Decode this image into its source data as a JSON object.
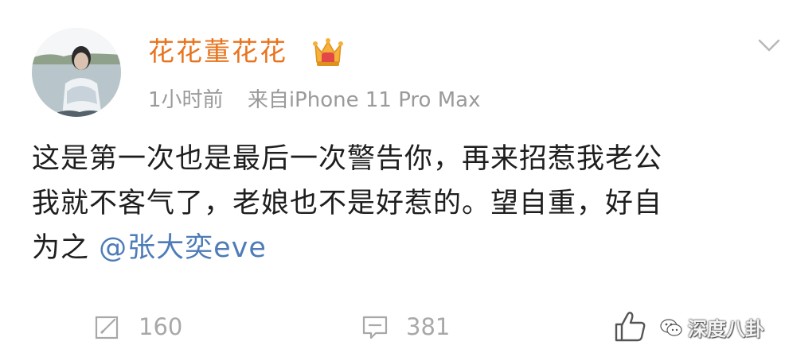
{
  "post": {
    "author": {
      "name": "花花董花花"
    },
    "time": "1小时前",
    "source": "来自iPhone 11 Pro Max",
    "text_lines": [
      "这是第一次也是最后一次警告你，再来招惹我老公",
      "我就不客气了，老娘也不是好惹的。望自重，好自",
      "为之 "
    ],
    "mention": "@张大奕eve"
  },
  "footer": {
    "repost_count": "160",
    "comment_count": "381"
  },
  "watermark": {
    "text": "深度八卦"
  },
  "colors": {
    "username": "#e8741f",
    "mention": "#4d7cb8",
    "meta": "#9a9a9a",
    "action": "#a8a8a8"
  }
}
